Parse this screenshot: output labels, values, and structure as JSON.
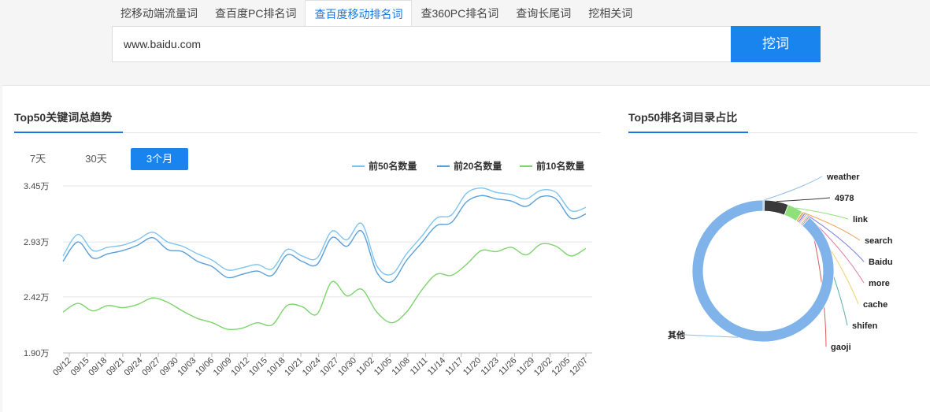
{
  "tabs": [
    {
      "label": "挖移动端流量词",
      "active": false
    },
    {
      "label": "查百度PC排名词",
      "active": false
    },
    {
      "label": "查百度移动排名词",
      "active": true
    },
    {
      "label": "查360PC排名词",
      "active": false
    },
    {
      "label": "查询长尾词",
      "active": false
    },
    {
      "label": "挖相关词",
      "active": false
    }
  ],
  "search": {
    "value": "www.baidu.com",
    "button_label": "挖词"
  },
  "trend": {
    "title": "Top50关键词总趋势",
    "ranges": [
      "7天",
      "30天",
      "3个月"
    ],
    "active_range": "3个月"
  },
  "pie_section": {
    "title": "Top50排名词目录占比"
  },
  "colors": {
    "accent": "#1a84ee",
    "top50": "#7ec4ef",
    "top20": "#5b9fd8",
    "top10": "#7ed46c",
    "pie_main": "#7fb3ea",
    "pie_dark": "#3a3a3a",
    "pie_green": "#8fe07a"
  },
  "chart_data": [
    {
      "type": "line",
      "title": "",
      "yticks": [
        "3.45万",
        "2.93万",
        "2.42万",
        "1.90万"
      ],
      "ylim": [
        19000,
        34500
      ],
      "x": [
        "09/12",
        "09/15",
        "09/18",
        "09/21",
        "09/24",
        "09/27",
        "09/30",
        "10/03",
        "10/06",
        "10/09",
        "10/12",
        "10/15",
        "10/18",
        "10/21",
        "10/24",
        "10/27",
        "10/30",
        "11/02",
        "11/05",
        "11/08",
        "11/11",
        "11/14",
        "11/17",
        "11/20",
        "11/23",
        "11/26",
        "11/29",
        "12/02",
        "12/05",
        "12/07"
      ],
      "series": [
        {
          "name": "前50名数量",
          "color": "#7ec4ef",
          "values": [
            28000,
            30000,
            28500,
            28800,
            29000,
            29500,
            30200,
            29300,
            28900,
            28200,
            27600,
            26700,
            26900,
            27200,
            26800,
            28600,
            28000,
            27800,
            30300,
            29500,
            31000,
            27100,
            26300,
            28200,
            29800,
            31500,
            31800,
            33800,
            34300,
            33900,
            33700,
            33300,
            34100,
            33900,
            32200,
            32500
          ]
        },
        {
          "name": "前20名数量",
          "color": "#5b9fd8",
          "values": [
            27500,
            29300,
            27800,
            28200,
            28500,
            29000,
            29700,
            28600,
            28400,
            27500,
            27000,
            26000,
            26300,
            26600,
            26200,
            28100,
            27500,
            27200,
            29700,
            28900,
            30300,
            26500,
            25600,
            27600,
            29200,
            30800,
            31100,
            33000,
            33600,
            33300,
            33100,
            32600,
            33500,
            33300,
            31500,
            31900
          ]
        },
        {
          "name": "前10名数量",
          "color": "#7ed46c",
          "values": [
            22800,
            23600,
            22900,
            23400,
            23200,
            23500,
            24100,
            23700,
            22900,
            22200,
            21800,
            21200,
            21300,
            21800,
            21600,
            23400,
            23300,
            22600,
            25600,
            24300,
            24900,
            22800,
            21800,
            22800,
            24800,
            26300,
            26200,
            27200,
            28500,
            28400,
            28800,
            28100,
            29100,
            28900,
            28000,
            28700
          ]
        }
      ]
    },
    {
      "type": "pie",
      "title": "",
      "labels": [
        "weather",
        "4978",
        "link",
        "search",
        "Baidu",
        "more",
        "cache",
        "shifen",
        "gaoji",
        "其他"
      ],
      "values": [
        0.3,
        5.5,
        3.5,
        0.5,
        0.4,
        0.3,
        0.3,
        0.3,
        0.3,
        88.6
      ],
      "colors": [
        "#7fb3ea",
        "#3a3a3a",
        "#8fe07a",
        "#f3a35b",
        "#7b7fe0",
        "#e57aa6",
        "#f2d16b",
        "#5ab0a5",
        "#d65b5b",
        "#7fb3ea"
      ]
    }
  ]
}
